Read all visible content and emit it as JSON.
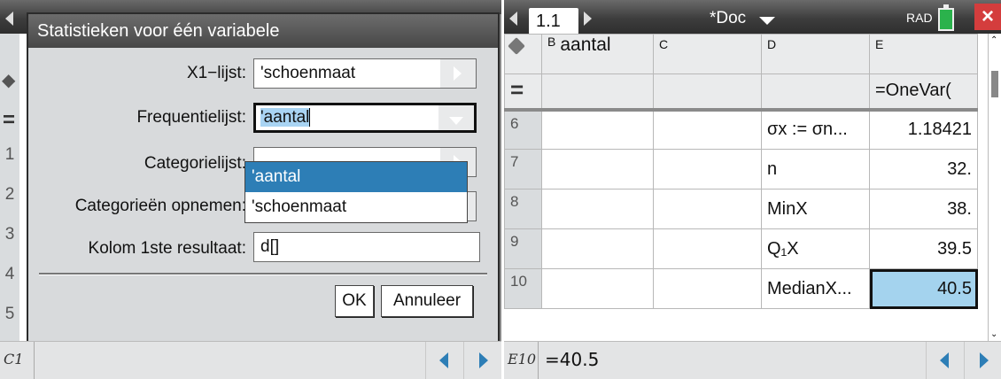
{
  "left": {
    "row_numbers": [
      "1",
      "2",
      "3",
      "4",
      "5"
    ],
    "status_ref": "C1",
    "dialog": {
      "title": "Statistieken voor één variabele",
      "fields": [
        {
          "label": "X1−lijst:",
          "value": "'schoenmaat"
        },
        {
          "label": "Frequentielijst:",
          "value": "'aantal"
        },
        {
          "label": "Categorielijst:",
          "value": ""
        },
        {
          "label": "Categorieën opnemen:",
          "value": ""
        },
        {
          "label": "Kolom 1ste resultaat:",
          "value": "d[]"
        }
      ],
      "dropdown_options": [
        "'aantal",
        "'schoenmaat"
      ],
      "ok_label": "OK",
      "cancel_label": "Annuleer"
    }
  },
  "right": {
    "tab_label": "1.1",
    "doc_title": "*Doc",
    "angle_mode": "RAD",
    "close_glyph": "×",
    "columns": [
      {
        "letter": "B",
        "name": "aantal"
      },
      {
        "letter": "C",
        "name": ""
      },
      {
        "letter": "D",
        "name": ""
      },
      {
        "letter": "E",
        "name": ""
      }
    ],
    "formula_row": {
      "symbol": "=",
      "e_formula": "=OneVar("
    },
    "rows": [
      {
        "num": "6",
        "d": "σx := σn...",
        "e": "1.18421"
      },
      {
        "num": "7",
        "d": "n",
        "e": "32."
      },
      {
        "num": "8",
        "d": "MinX",
        "e": "38."
      },
      {
        "num": "9",
        "d": "Q₁X",
        "e": "39.5"
      },
      {
        "num": "10",
        "d": "MedianX...",
        "e": "40.5"
      }
    ],
    "status_ref": "E10",
    "status_formula": "=40.5"
  },
  "colors": {
    "accent": "#2d7eb6",
    "selection": "#a4d3ee",
    "titlebar": "#3d3d3d"
  }
}
